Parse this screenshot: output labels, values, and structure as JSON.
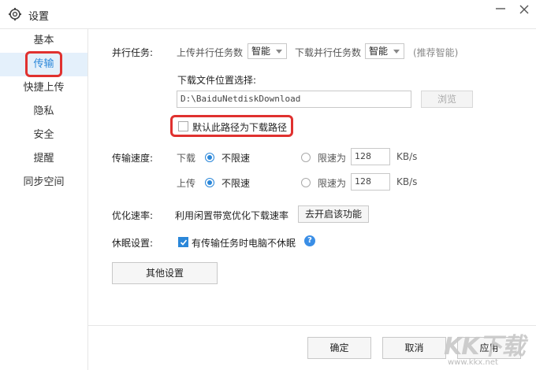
{
  "window": {
    "title": "设置"
  },
  "sidebar": {
    "items": [
      {
        "label": "基本"
      },
      {
        "label": "传输"
      },
      {
        "label": "快捷上传"
      },
      {
        "label": "隐私"
      },
      {
        "label": "安全"
      },
      {
        "label": "提醒"
      },
      {
        "label": "同步空间"
      }
    ],
    "active": "传输"
  },
  "parallel": {
    "label": "并行任务:",
    "upload_label": "上传并行任务数",
    "upload_value": "智能",
    "download_label": "下载并行任务数",
    "download_value": "智能",
    "recommend": "(推荐智能)"
  },
  "download_location": {
    "label": "下载文件位置选择:",
    "path": "D:\\BaiduNetdiskDownload",
    "browse_label": "浏览",
    "default_checkbox_label": "默认此路径为下载路径",
    "default_checked": false
  },
  "speed": {
    "label": "传输速度:",
    "download": {
      "label": "下载",
      "unlimited_label": "不限速",
      "limit_label": "限速为",
      "limit_value": "128",
      "unit": "KB/s",
      "selected": "unlimited"
    },
    "upload": {
      "label": "上传",
      "unlimited_label": "不限速",
      "limit_label": "限速为",
      "limit_value": "128",
      "unit": "KB/s",
      "selected": "unlimited"
    }
  },
  "optimize": {
    "label": "优化速率:",
    "desc": "利用闲置带宽优化下载速率",
    "button_label": "去开启该功能"
  },
  "sleep": {
    "label": "休眠设置:",
    "checkbox_label": "有传输任务时电脑不休眠",
    "checked": true,
    "help_glyph": "?"
  },
  "other_settings_label": "其他设置",
  "footer": {
    "ok_label": "确定",
    "cancel_label": "取消",
    "apply_label": "应用"
  },
  "watermark": {
    "logo": "KK下载",
    "url": "www.kkx.net"
  },
  "colors": {
    "accent": "#2b87d9",
    "highlight": "#e0312f",
    "active_bg": "#e4f0fb"
  }
}
